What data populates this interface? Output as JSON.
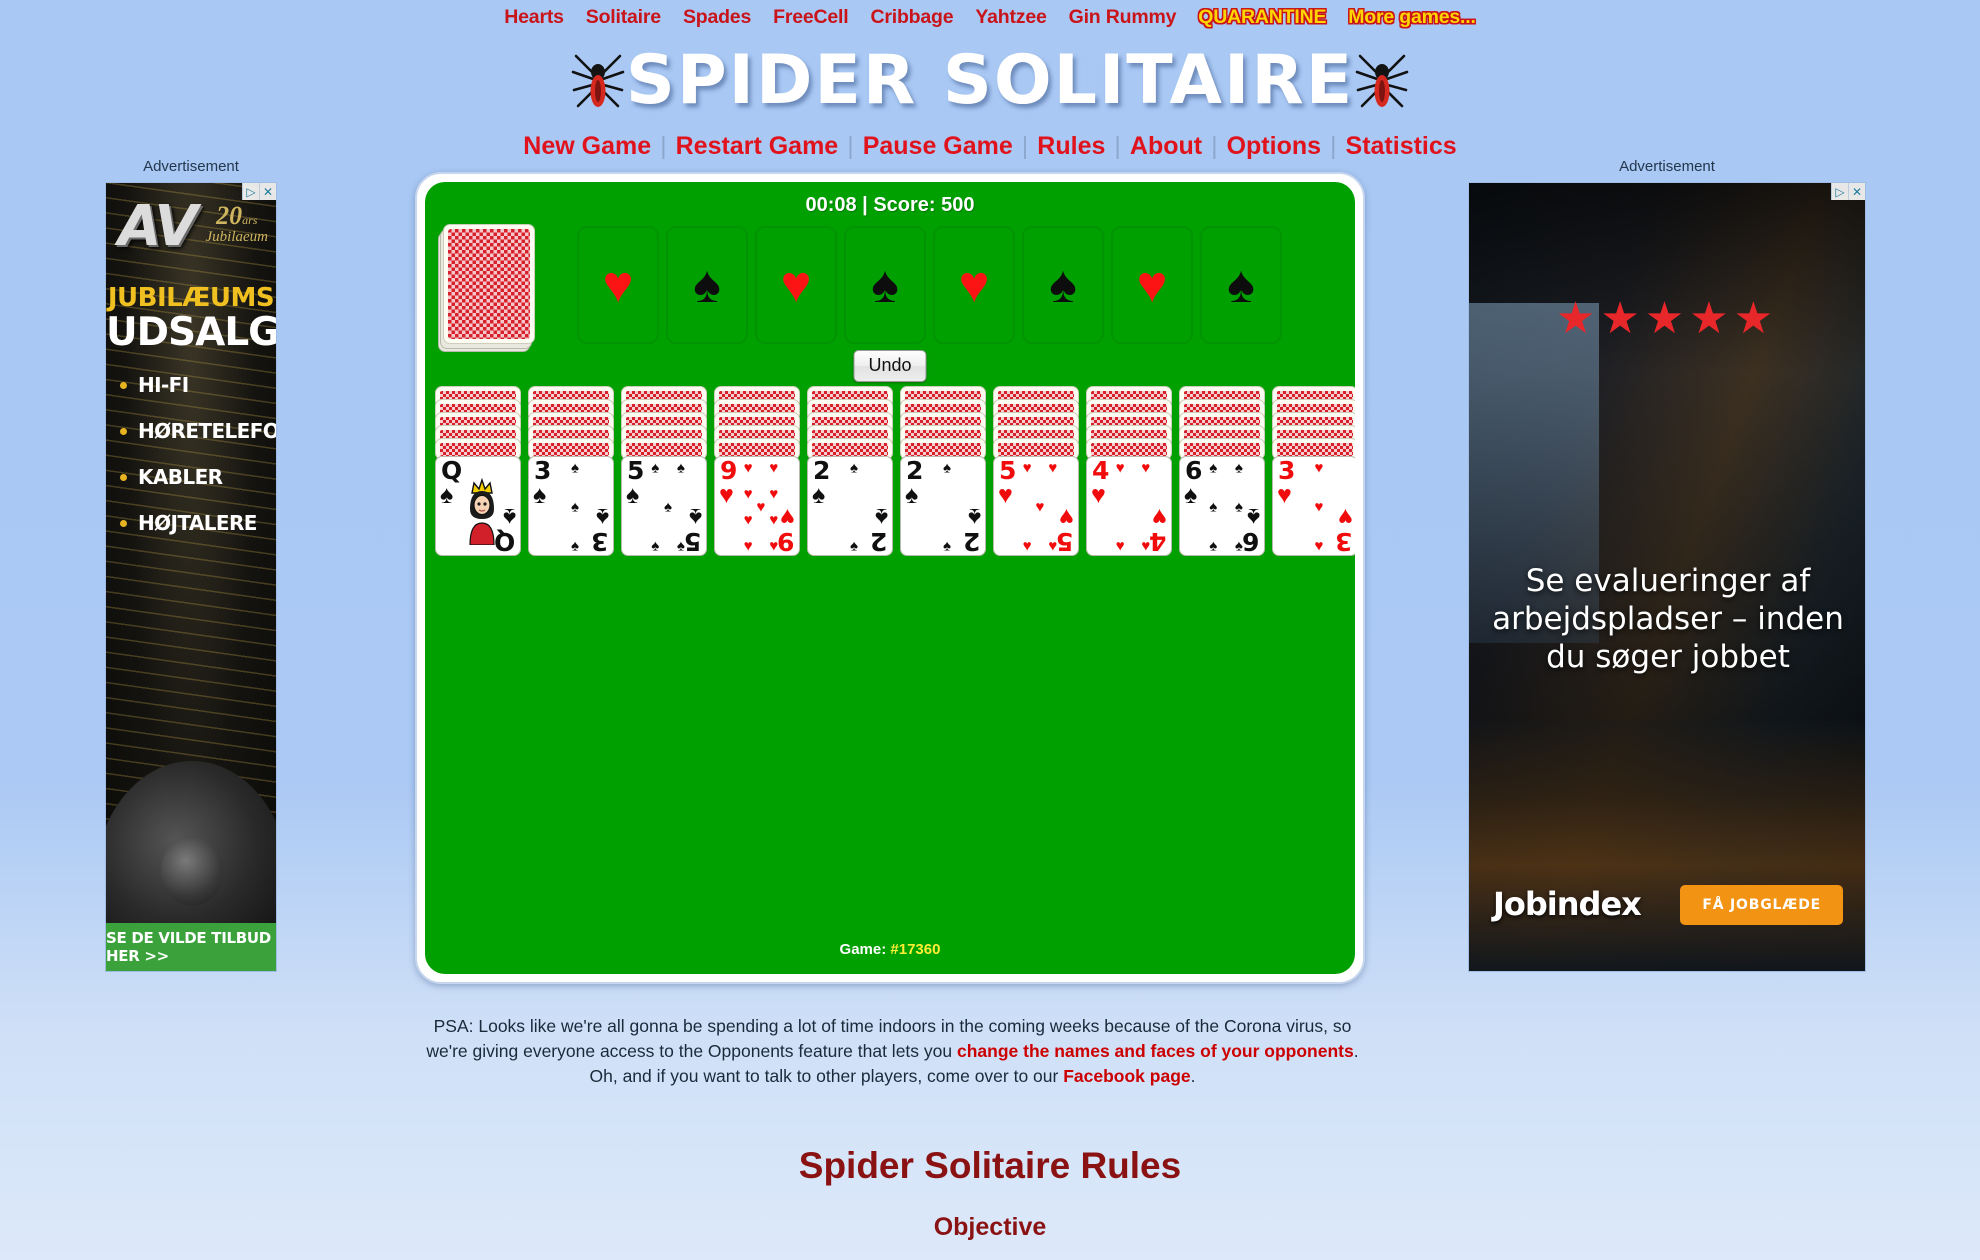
{
  "colors": {
    "page_bg": "#abc9f4",
    "nav_link": "#c9141a",
    "nav_hilite": "#ffd400",
    "menu_link": "#e0121b",
    "felt_green": "#00a000",
    "heading_dark_red": "#8a1212",
    "card_red": "#f00c0c",
    "card_black": "#101010",
    "game_number": "#ffee33"
  },
  "topnav": {
    "items": [
      {
        "label": "Hearts",
        "style": "normal"
      },
      {
        "label": "Solitaire",
        "style": "normal"
      },
      {
        "label": "Spades",
        "style": "normal"
      },
      {
        "label": "FreeCell",
        "style": "normal"
      },
      {
        "label": "Cribbage",
        "style": "normal"
      },
      {
        "label": "Yahtzee",
        "style": "normal"
      },
      {
        "label": "Gin Rummy",
        "style": "normal"
      },
      {
        "label": "QUARANTINE",
        "style": "hilite"
      },
      {
        "label": "More games...",
        "style": "hilite"
      }
    ]
  },
  "header": {
    "title": "SPIDER SOLITAIRE",
    "left_icon": "spider-icon",
    "right_icon": "spider-icon"
  },
  "gamemenu": {
    "separator": "|",
    "items": [
      {
        "label": "New Game"
      },
      {
        "label": "Restart Game"
      },
      {
        "label": "Pause Game"
      },
      {
        "label": "Rules"
      },
      {
        "label": "About"
      },
      {
        "label": "Options"
      },
      {
        "label": "Statistics"
      }
    ]
  },
  "game": {
    "timer": "00:08",
    "score_label": "Score: 500",
    "status_line": "00:08 | Score: 500",
    "undo_label": "Undo",
    "game_number_label": "Game:",
    "game_number": "#17360",
    "stock": {
      "name": "stock-pile",
      "cards_remaining_visual": 3
    },
    "foundations": [
      {
        "suit": "hearts",
        "symbol": "♥",
        "color": "red"
      },
      {
        "suit": "spades",
        "symbol": "♠",
        "color": "black"
      },
      {
        "suit": "hearts",
        "symbol": "♥",
        "color": "red"
      },
      {
        "suit": "spades",
        "symbol": "♠",
        "color": "black"
      },
      {
        "suit": "hearts",
        "symbol": "♥",
        "color": "red"
      },
      {
        "suit": "spades",
        "symbol": "♠",
        "color": "black"
      },
      {
        "suit": "hearts",
        "symbol": "♥",
        "color": "red"
      },
      {
        "suit": "spades",
        "symbol": "♠",
        "color": "black"
      }
    ],
    "tableau": [
      {
        "facedown": 5,
        "faceup": {
          "rank": "Q",
          "suit": "spades",
          "symbol": "♠",
          "color": "black",
          "court": true
        }
      },
      {
        "facedown": 5,
        "faceup": {
          "rank": "3",
          "suit": "spades",
          "symbol": "♠",
          "color": "black",
          "court": false
        }
      },
      {
        "facedown": 5,
        "faceup": {
          "rank": "5",
          "suit": "spades",
          "symbol": "♠",
          "color": "black",
          "court": false
        }
      },
      {
        "facedown": 5,
        "faceup": {
          "rank": "9",
          "suit": "hearts",
          "symbol": "♥",
          "color": "red",
          "court": false
        }
      },
      {
        "facedown": 5,
        "faceup": {
          "rank": "2",
          "suit": "spades",
          "symbol": "♠",
          "color": "black",
          "court": false
        }
      },
      {
        "facedown": 5,
        "faceup": {
          "rank": "2",
          "suit": "spades",
          "symbol": "♠",
          "color": "black",
          "court": false
        }
      },
      {
        "facedown": 5,
        "faceup": {
          "rank": "5",
          "suit": "hearts",
          "symbol": "♥",
          "color": "red",
          "court": false
        }
      },
      {
        "facedown": 5,
        "faceup": {
          "rank": "4",
          "suit": "hearts",
          "symbol": "♥",
          "color": "red",
          "court": false
        }
      },
      {
        "facedown": 5,
        "faceup": {
          "rank": "6",
          "suit": "spades",
          "symbol": "♠",
          "color": "black",
          "court": false
        }
      },
      {
        "facedown": 5,
        "faceup": {
          "rank": "3",
          "suit": "hearts",
          "symbol": "♥",
          "color": "red",
          "court": false
        }
      }
    ]
  },
  "ads": {
    "label": "Advertisement",
    "choices_icons": [
      "adchoices-play-icon",
      "adchoices-close-icon"
    ],
    "left": {
      "brand": "AV",
      "anniversary_number": "20",
      "anniversary_unit": "ars",
      "anniversary_word": "Jubilaeum",
      "headline1": "JUBILÆUMS",
      "headline2": "UDSALG",
      "bullets": [
        "HI-FI",
        "HØRETELEFONER",
        "KABLER",
        "HØJTALERE"
      ],
      "cta": "SE DE VILDE TILBUD HER >>"
    },
    "right": {
      "stars": "★★★★★",
      "copy": "Se evalueringer af arbejdspladser – inden du søger jobbet",
      "logo": "Jobindex",
      "cta": "FÅ JOBGLÆDE"
    }
  },
  "psa": {
    "part1": "PSA: Looks like we're all gonna be spending a lot of time indoors in the coming weeks because of the Corona virus, so we're giving everyone access to the Opponents feature that lets you ",
    "link1": "change the names and faces of your opponents",
    "part2": ". Oh, and if you want to talk to other players, come over to our ",
    "link2": "Facebook page",
    "part3": "."
  },
  "rules": {
    "title": "Spider Solitaire Rules",
    "subtitle": "Objective"
  }
}
